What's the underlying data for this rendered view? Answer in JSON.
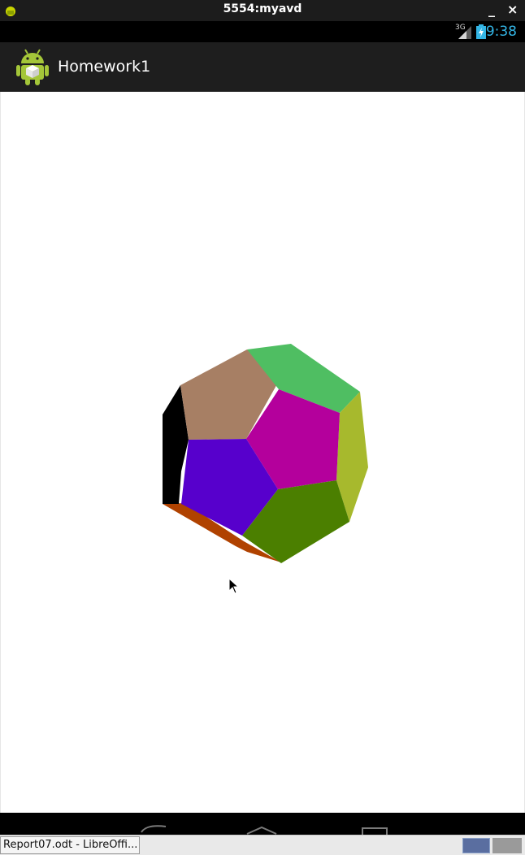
{
  "window": {
    "title": "5554:myavd",
    "minimize_label": "_",
    "close_label": "×"
  },
  "status": {
    "network": "3G",
    "time": "9:38",
    "accent": "#33b5e5"
  },
  "actionbar": {
    "app_name": "Homework1"
  },
  "faces": {
    "left_black": "#000000",
    "top_brown": "#a77f64",
    "top_green": "#4fbe62",
    "center_magenta": "#b4009c",
    "right_olive": "#a7b92d",
    "left_indigo": "#5700cc",
    "bottom_green": "#4b7f00",
    "bottom_orange": "#b04200"
  },
  "taskbar": {
    "window_label": "Report07.odt - LibreOffi..."
  }
}
